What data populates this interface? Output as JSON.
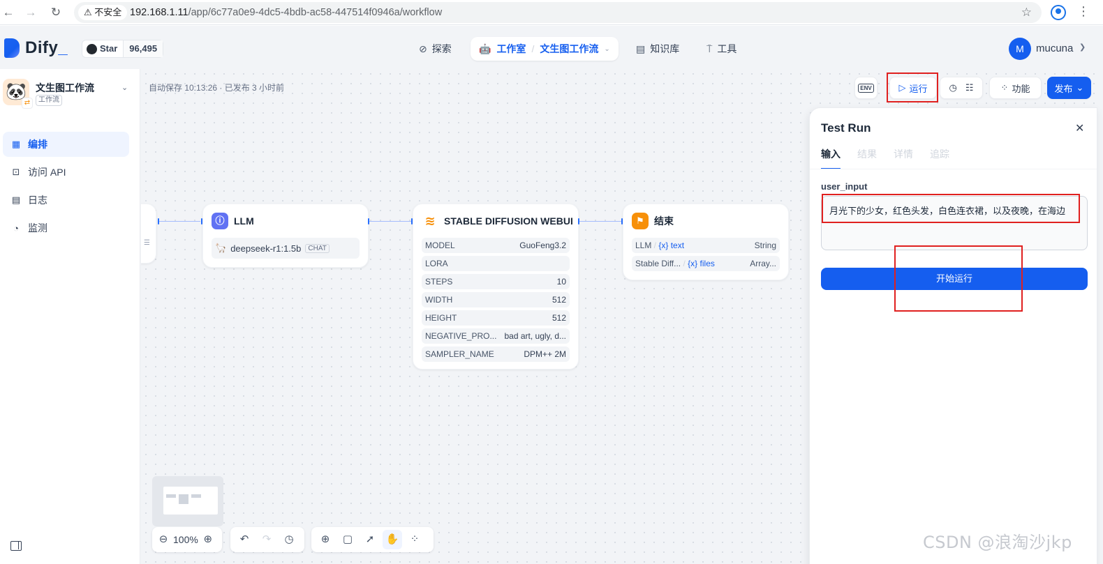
{
  "browser": {
    "insecure_label": "不安全",
    "url_host": "192.168.1.11",
    "url_path": "/app/6c77a0e9-4dc5-4bdb-ac58-447514f0946a/workflow"
  },
  "header": {
    "brand": "Dify",
    "github_label": "Star",
    "github_count": "96,495",
    "nav": {
      "explore": "探索",
      "workspace": "工作室",
      "current_app": "文生图工作流",
      "knowledge": "知识库",
      "tools": "工具"
    },
    "user_initial": "M",
    "username": "mucuna"
  },
  "sidebar": {
    "app_name": "文生图工作流",
    "app_type": "工作流",
    "items": [
      {
        "label": "编排",
        "icon": "layout-icon"
      },
      {
        "label": "访问 API",
        "icon": "terminal-icon"
      },
      {
        "label": "日志",
        "icon": "file-list-icon"
      },
      {
        "label": "监测",
        "icon": "monitor-icon"
      }
    ]
  },
  "toolbar": {
    "autosave": "自动保存 10:13:26 · 已发布 3 小时前",
    "env_label": "ENV",
    "run_label": "运行",
    "features_label": "功能",
    "publish_label": "发布"
  },
  "nodes": {
    "llm": {
      "title": "LLM",
      "model": "deepseek-r1:1.5b",
      "mode": "CHAT"
    },
    "sd": {
      "title": "STABLE DIFFUSION WEBUI",
      "params": [
        {
          "key": "MODEL",
          "value": "GuoFeng3.2"
        },
        {
          "key": "LORA",
          "value": ""
        },
        {
          "key": "STEPS",
          "value": "10"
        },
        {
          "key": "WIDTH",
          "value": "512"
        },
        {
          "key": "HEIGHT",
          "value": "512"
        },
        {
          "key": "NEGATIVE_PRO...",
          "value": "bad art, ugly, d..."
        },
        {
          "key": "SAMPLER_NAME",
          "value": "DPM++ 2M"
        }
      ]
    },
    "end": {
      "title": "结束",
      "outputs": [
        {
          "source": "LLM",
          "var": "text",
          "type": "String"
        },
        {
          "source": "Stable Diff...",
          "var": "files",
          "type": "Array..."
        }
      ]
    }
  },
  "zoom": {
    "level": "100%"
  },
  "test_run": {
    "title": "Test Run",
    "tabs": [
      "输入",
      "结果",
      "详情",
      "追踪"
    ],
    "field_label": "user_input",
    "field_value": "月光下的少女，红色头发，白色连衣裙，以及夜晚，在海边",
    "start_label": "开始运行"
  },
  "watermark": "CSDN @浪淘沙jkp",
  "colors": {
    "accent": "#155eef",
    "annotation_red": "#e0201f"
  }
}
